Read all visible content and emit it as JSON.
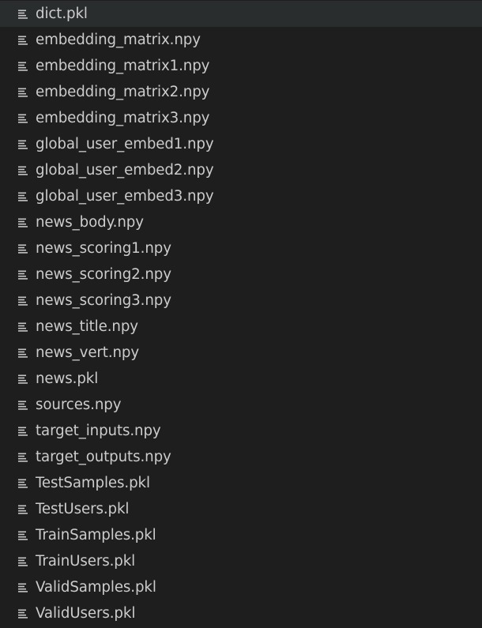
{
  "explorer": {
    "icon_name": "file-lines-icon",
    "text_color": "#cccccc",
    "icon_color": "#c5c5c5",
    "background": "#1e1e1e",
    "hover_background": "#2a2d2e",
    "files": [
      "dict.pkl",
      "embedding_matrix.npy",
      "embedding_matrix1.npy",
      "embedding_matrix2.npy",
      "embedding_matrix3.npy",
      "global_user_embed1.npy",
      "global_user_embed2.npy",
      "global_user_embed3.npy",
      "news_body.npy",
      "news_scoring1.npy",
      "news_scoring2.npy",
      "news_scoring3.npy",
      "news_title.npy",
      "news_vert.npy",
      "news.pkl",
      "sources.npy",
      "target_inputs.npy",
      "target_outputs.npy",
      "TestSamples.pkl",
      "TestUsers.pkl",
      "TrainSamples.pkl",
      "TrainUsers.pkl",
      "ValidSamples.pkl",
      "ValidUsers.pkl"
    ]
  }
}
